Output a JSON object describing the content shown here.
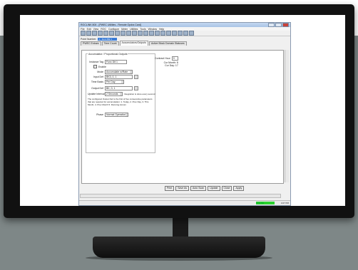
{
  "window": {
    "title": "ROCLINK 800 - [PWEC Utilities - Remote Opdra Card]"
  },
  "menu": [
    "File",
    "Edit",
    "View",
    "ROC",
    "Configure",
    "Meter",
    "Utilities",
    "Tools",
    "Window",
    "Help"
  ],
  "point": {
    "label": "Point Number:",
    "value": "1 - Func Blk 1"
  },
  "tabs": [
    "PWEC Enbars",
    "Time Count",
    "Accumulators/Outputs",
    "Active Block Domain Statuses"
  ],
  "group": {
    "title": "Accumulator / Proportional Outputs",
    "instance_tag_label": "Instance Tag",
    "instance_tag_value": "Func Dit 1",
    "enable_label": "Enable",
    "mode_label": "Mode",
    "mode_value": "Accumulate w/Rate",
    "input_def_label": "Input Def",
    "input_def_value": "BK3, 0, 1",
    "time_basis_label": "Time Basis",
    "time_basis_value": "Per Day",
    "output_def_label": "Output Def",
    "output_def_value": "BK, 0, 1",
    "update_interval_label": "Update Interval",
    "update_interval_value": "2 Seconds",
    "update_note": "Integration is done every second",
    "description": "The configured Output Def is the first of five consecutive parameters that are required for accumulation: 1. Today, 2. Prev Day, 3. This Month, 4. Prev Month 5. Running Accum",
    "phase_label": "Phase",
    "phase_value": "Normal Operation"
  },
  "right_info": {
    "contract_hour_label": "Contract Hour",
    "contract_hour_value": "0",
    "cur_month": "Cur Month: 8",
    "cur_day": "Cur Day: 17"
  },
  "buttons": [
    "Print",
    "Save As",
    "Auto Scan",
    "Update",
    "Close",
    "Apply"
  ],
  "status": {
    "indicator": "ONLINE",
    "time": "4:07 PM"
  }
}
